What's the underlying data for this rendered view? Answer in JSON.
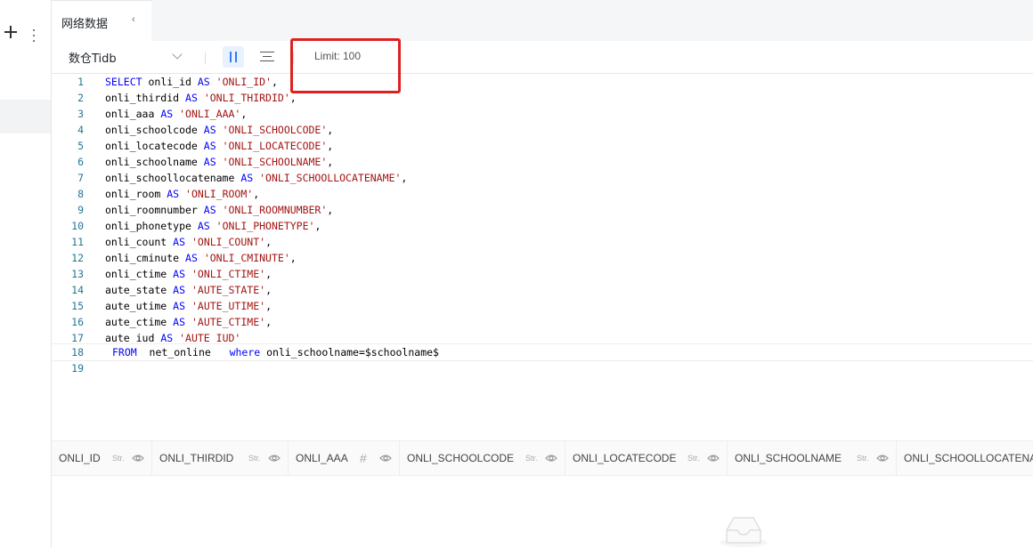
{
  "tab": {
    "title": "网络数据",
    "collapse_glyph": "‹"
  },
  "toolbar": {
    "database": "数仓Tidb",
    "limit": "Limit: 100"
  },
  "editor": {
    "lines": [
      {
        "n": "1"
      },
      {
        "n": "2"
      },
      {
        "n": "3"
      },
      {
        "n": "4"
      },
      {
        "n": "5"
      },
      {
        "n": "6"
      },
      {
        "n": "7"
      },
      {
        "n": "8"
      },
      {
        "n": "9"
      },
      {
        "n": "10"
      },
      {
        "n": "11"
      },
      {
        "n": "12"
      },
      {
        "n": "13"
      },
      {
        "n": "14"
      },
      {
        "n": "15"
      },
      {
        "n": "16"
      },
      {
        "n": "17"
      },
      {
        "n": "18"
      },
      {
        "n": "19"
      }
    ],
    "sql": {
      "l1_a": "SELECT",
      "l1_b": " onli_id ",
      "l1_c": "AS",
      "l1_d": " ",
      "l1_e": "'ONLI_ID'",
      "l1_f": ",",
      "l2_b": "onli_thirdid ",
      "l2_e": "'ONLI_THIRDID'",
      "l3_b": "onli_aaa ",
      "l3_e": "'ONLI_AAA'",
      "l4_b": "onli_schoolcode ",
      "l4_e": "'ONLI_SCHOOLCODE'",
      "l5_b": "onli_locatecode ",
      "l5_e": "'ONLI_LOCATECODE'",
      "l6_b": "onli_schoolname ",
      "l6_e": "'ONLI_SCHOOLNAME'",
      "l7_b": "onli_schoollocatename ",
      "l7_e": "'ONLI_SCHOOLLOCATENAME'",
      "l8_b": "onli_room ",
      "l8_e": "'ONLI_ROOM'",
      "l9_b": "onli_roomnumber ",
      "l9_e": "'ONLI_ROOMNUMBER'",
      "l10_b": "onli_phonetype ",
      "l10_e": "'ONLI_PHONETYPE'",
      "l11_b": "onli_count ",
      "l11_e": "'ONLI_COUNT'",
      "l12_b": "onli_cminute ",
      "l12_e": "'ONLI_CMINUTE'",
      "l13_b": "onli_ctime ",
      "l13_e": "'ONLI_CTIME'",
      "l14_b": "aute_state ",
      "l14_e": "'AUTE_STATE'",
      "l15_b": "aute_utime ",
      "l15_e": "'AUTE_UTIME'",
      "l16_b": "aute_ctime ",
      "l16_e": "'AUTE_CTIME'",
      "l17_b": "aute_iud ",
      "l17_e": "'AUTE_IUD'",
      "as": "AS",
      "comma": ",",
      "from": "FROM",
      "table": "  net_online   ",
      "where": "where",
      "cond": " onli_schoolname=$schoolname$"
    }
  },
  "results": {
    "columns": [
      {
        "name": "ONLI_ID",
        "type": "Str."
      },
      {
        "name": "ONLI_THIRDID",
        "type": "Str."
      },
      {
        "name": "ONLI_AAA",
        "type": "#"
      },
      {
        "name": "ONLI_SCHOOLCODE",
        "type": "Str."
      },
      {
        "name": "ONLI_LOCATECODE",
        "type": "Str."
      },
      {
        "name": "ONLI_SCHOOLNAME",
        "type": "Str."
      },
      {
        "name": "ONLI_SCHOOLLOCATENAME",
        "type": ""
      }
    ]
  },
  "colors": {
    "keyword": "#0000ff",
    "string": "#a31515",
    "line_number": "#237893",
    "accent": "#2f7cf6",
    "highlight_box": "#e02020"
  },
  "icons": {
    "rail_add": "plus-icon",
    "rail_more": "more-vertical-icon",
    "pause": "pause-icon",
    "format": "align-center-icon",
    "column_visibility": "eye-icon",
    "empty": "empty-inbox-icon"
  }
}
